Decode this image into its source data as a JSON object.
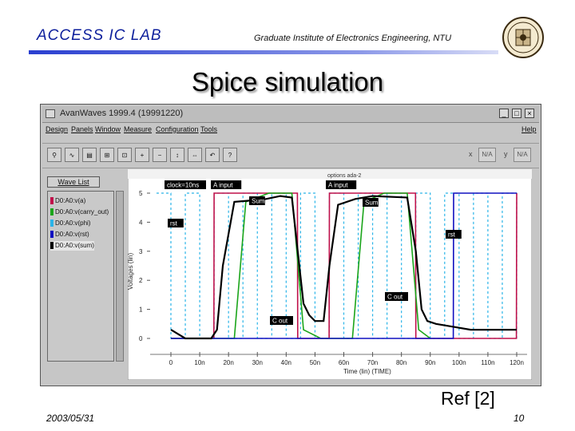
{
  "header": {
    "lab": "ACCESS IC LAB",
    "institute": "Graduate Institute of Electronics Engineering, NTU"
  },
  "title": "Spice simulation",
  "window": {
    "title": "AvanWaves 1999.4 (19991220)",
    "buttons": [
      "_",
      "□",
      "×"
    ],
    "menu": [
      "Design",
      "Panels",
      "Window",
      "Measure",
      "Configuration",
      "Tools",
      "Help"
    ],
    "readout": {
      "x_label": "x",
      "x_value": "N/A",
      "y_label": "y",
      "y_value": "N/A"
    },
    "wave_list_button": "Wave List",
    "wave_list": [
      {
        "label": "D0:A0:v(a)",
        "color": "#c0104a"
      },
      {
        "label": "D0:A0:v(carry_out)",
        "color": "#1aa51a"
      },
      {
        "label": "D0:A0:v(phi)",
        "color": "#2ab4e8"
      },
      {
        "label": "D0:A0:v(rst)",
        "color": "#1010c0"
      },
      {
        "label": "D0:A0:v(sum)",
        "color": "#000000"
      }
    ]
  },
  "plot": {
    "heading": "options ada-2",
    "ylabel": "Voltages (lin)",
    "xlabel": "Time (lin) (TIME)",
    "yticks": [
      "5",
      "4",
      "3",
      "2",
      "1",
      "0"
    ],
    "xticks": [
      "0",
      "10n",
      "20n",
      "30n",
      "40n",
      "50n",
      "60n",
      "70n",
      "80n",
      "90n",
      "100n",
      "110n",
      "120n"
    ],
    "annotations": [
      "clock=10ns",
      "A input",
      "A input",
      "Sum",
      "Sum",
      "rst",
      "rst",
      "C out",
      "C out"
    ]
  },
  "chart_data": {
    "type": "line",
    "title": "options ada-2",
    "xlabel": "Time (lin) (TIME)",
    "ylabel": "Voltages (lin)",
    "xlim": [
      -5,
      122
    ],
    "ylim": [
      -0.2,
      5.2
    ],
    "series": [
      {
        "name": "D0:A0:v(a)",
        "color": "#c0104a",
        "points": [
          [
            0,
            0
          ],
          [
            14.9,
            0
          ],
          [
            15,
            5
          ],
          [
            43.9,
            5
          ],
          [
            44,
            0
          ],
          [
            54.9,
            0
          ],
          [
            55,
            5
          ],
          [
            84.9,
            5
          ],
          [
            85,
            0
          ],
          [
            119.9,
            0
          ],
          [
            120,
            5
          ]
        ]
      },
      {
        "name": "D0:A0:v(carry_out)",
        "color": "#1aa51a",
        "points": [
          [
            0,
            0
          ],
          [
            22,
            0
          ],
          [
            26,
            4.7
          ],
          [
            34,
            5
          ],
          [
            42,
            5
          ],
          [
            46,
            0.3
          ],
          [
            52,
            0
          ],
          [
            63,
            0
          ],
          [
            67,
            4.7
          ],
          [
            74,
            5
          ],
          [
            82,
            5
          ],
          [
            86,
            0.3
          ],
          [
            90,
            0
          ]
        ]
      },
      {
        "name": "D0:A0:v(rst)",
        "color": "#1010c0",
        "points": [
          [
            0,
            0
          ],
          [
            98,
            0
          ],
          [
            98.1,
            5
          ],
          [
            120,
            5
          ]
        ]
      },
      {
        "name": "D0:A0:v(sum)",
        "color": "#000000",
        "points": [
          [
            0,
            0.3
          ],
          [
            5,
            0
          ],
          [
            14,
            0
          ],
          [
            16,
            0.3
          ],
          [
            18,
            2.5
          ],
          [
            22,
            4.7
          ],
          [
            28,
            4.75
          ],
          [
            33,
            4.8
          ],
          [
            38,
            4.9
          ],
          [
            42,
            4.85
          ],
          [
            44,
            3
          ],
          [
            46,
            1.2
          ],
          [
            48,
            0.8
          ],
          [
            50,
            0.6
          ],
          [
            53,
            0.6
          ],
          [
            55,
            2.5
          ],
          [
            58,
            4.6
          ],
          [
            64,
            4.8
          ],
          [
            70,
            4.9
          ],
          [
            82,
            4.85
          ],
          [
            85,
            3
          ],
          [
            87,
            1
          ],
          [
            89,
            0.6
          ],
          [
            92,
            0.5
          ],
          [
            98,
            0.4
          ],
          [
            104,
            0.3
          ],
          [
            110,
            0.3
          ],
          [
            120,
            0.3
          ]
        ]
      }
    ]
  },
  "footer": {
    "reference": "Ref [2]",
    "date": "2003/05/31",
    "page": "10"
  }
}
